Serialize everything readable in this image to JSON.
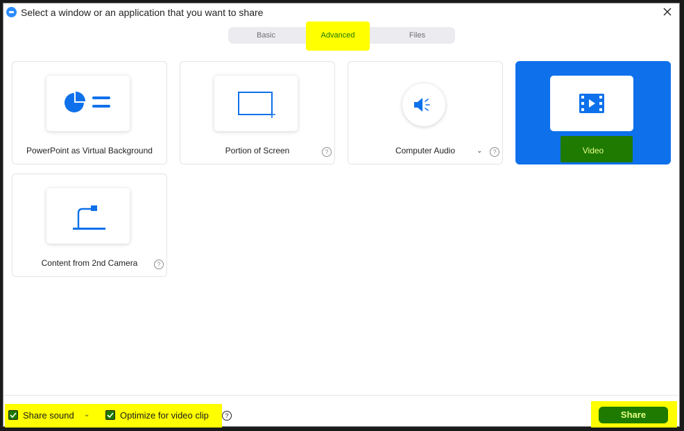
{
  "window": {
    "title": "Select a window or an application that you want to share"
  },
  "tabs": [
    {
      "label": "Basic"
    },
    {
      "label": "Advanced",
      "selected": true
    },
    {
      "label": "Files"
    }
  ],
  "options": [
    {
      "label": "PowerPoint as Virtual Background",
      "icon": "powerpoint-background-icon"
    },
    {
      "label": "Portion of Screen",
      "icon": "portion-screen-icon",
      "help": "?"
    },
    {
      "label": "Computer Audio",
      "icon": "speaker-icon",
      "help": "?"
    },
    {
      "label": "Video",
      "icon": "film-icon",
      "selected": true
    },
    {
      "label": "Content from 2nd Camera",
      "icon": "document-camera-icon",
      "help": "?"
    }
  ],
  "footer": {
    "share_sound_label": "Share sound",
    "optimize_label": "Optimize for video clip",
    "help": "?",
    "share_button": "Share"
  },
  "colors": {
    "accent_blue": "#0e71eb",
    "highlight_yellow": "#ffff00",
    "highlight_green": "#1e7a00"
  }
}
